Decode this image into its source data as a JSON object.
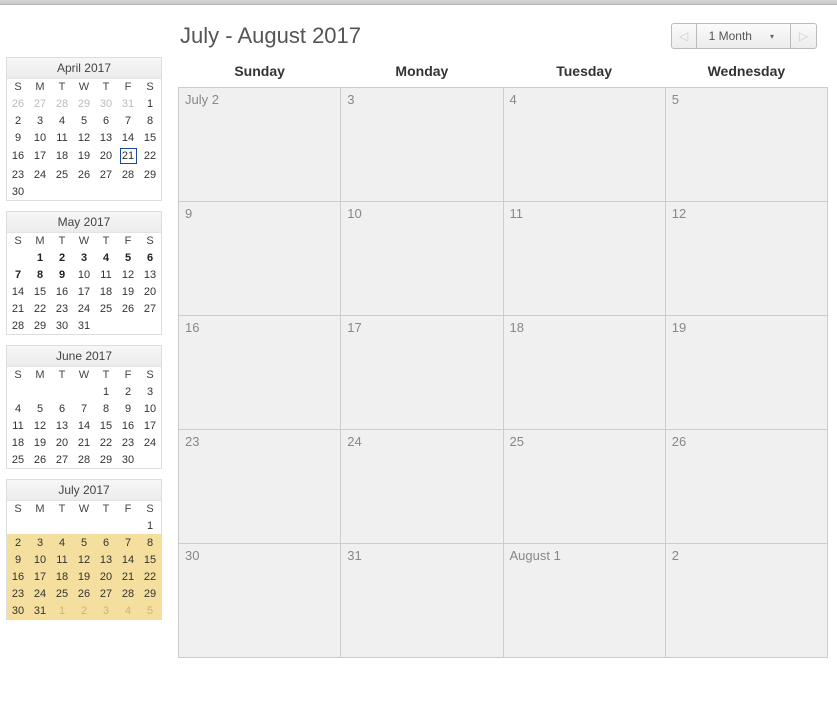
{
  "header": {
    "title": "July - August 2017",
    "range_label": "1 Month"
  },
  "day_short": [
    "S",
    "M",
    "T",
    "W",
    "T",
    "F",
    "S"
  ],
  "main_headers": [
    "Sunday",
    "Monday",
    "Tuesday",
    "Wednesday"
  ],
  "main_weeks": [
    [
      {
        "t": "July 2"
      },
      {
        "t": "3"
      },
      {
        "t": "4"
      },
      {
        "t": "5"
      }
    ],
    [
      {
        "t": "9"
      },
      {
        "t": "10"
      },
      {
        "t": "11"
      },
      {
        "t": "12"
      }
    ],
    [
      {
        "t": "16"
      },
      {
        "t": "17"
      },
      {
        "t": "18"
      },
      {
        "t": "19"
      }
    ],
    [
      {
        "t": "23"
      },
      {
        "t": "24"
      },
      {
        "t": "25"
      },
      {
        "t": "26"
      }
    ],
    [
      {
        "t": "30"
      },
      {
        "t": "31"
      },
      {
        "t": "August 1"
      },
      {
        "t": "2"
      }
    ]
  ],
  "minis": [
    {
      "title": "April 2017",
      "rows": [
        [
          {
            "t": "26",
            "cls": "mute"
          },
          {
            "t": "27",
            "cls": "mute"
          },
          {
            "t": "28",
            "cls": "mute"
          },
          {
            "t": "29",
            "cls": "mute"
          },
          {
            "t": "30",
            "cls": "mute"
          },
          {
            "t": "31",
            "cls": "mute"
          },
          {
            "t": "1"
          }
        ],
        [
          {
            "t": "2"
          },
          {
            "t": "3"
          },
          {
            "t": "4"
          },
          {
            "t": "5"
          },
          {
            "t": "6"
          },
          {
            "t": "7"
          },
          {
            "t": "8"
          }
        ],
        [
          {
            "t": "9"
          },
          {
            "t": "10"
          },
          {
            "t": "11"
          },
          {
            "t": "12"
          },
          {
            "t": "13"
          },
          {
            "t": "14"
          },
          {
            "t": "15"
          }
        ],
        [
          {
            "t": "16"
          },
          {
            "t": "17"
          },
          {
            "t": "18"
          },
          {
            "t": "19"
          },
          {
            "t": "20"
          },
          {
            "t": "21",
            "cls": "today"
          },
          {
            "t": "22"
          }
        ],
        [
          {
            "t": "23"
          },
          {
            "t": "24"
          },
          {
            "t": "25"
          },
          {
            "t": "26"
          },
          {
            "t": "27"
          },
          {
            "t": "28"
          },
          {
            "t": "29"
          }
        ],
        [
          {
            "t": "30"
          },
          {
            "t": ""
          },
          {
            "t": ""
          },
          {
            "t": ""
          },
          {
            "t": ""
          },
          {
            "t": ""
          },
          {
            "t": ""
          }
        ]
      ]
    },
    {
      "title": "May 2017",
      "rows": [
        [
          {
            "t": ""
          },
          {
            "t": "1",
            "cls": "bold"
          },
          {
            "t": "2",
            "cls": "bold"
          },
          {
            "t": "3",
            "cls": "bold"
          },
          {
            "t": "4",
            "cls": "bold"
          },
          {
            "t": "5",
            "cls": "bold"
          },
          {
            "t": "6",
            "cls": "bold"
          }
        ],
        [
          {
            "t": "7",
            "cls": "bold"
          },
          {
            "t": "8",
            "cls": "bold"
          },
          {
            "t": "9",
            "cls": "bold"
          },
          {
            "t": "10"
          },
          {
            "t": "11"
          },
          {
            "t": "12"
          },
          {
            "t": "13"
          }
        ],
        [
          {
            "t": "14"
          },
          {
            "t": "15"
          },
          {
            "t": "16"
          },
          {
            "t": "17"
          },
          {
            "t": "18"
          },
          {
            "t": "19"
          },
          {
            "t": "20"
          }
        ],
        [
          {
            "t": "21"
          },
          {
            "t": "22"
          },
          {
            "t": "23"
          },
          {
            "t": "24"
          },
          {
            "t": "25"
          },
          {
            "t": "26"
          },
          {
            "t": "27"
          }
        ],
        [
          {
            "t": "28"
          },
          {
            "t": "29"
          },
          {
            "t": "30"
          },
          {
            "t": "31"
          },
          {
            "t": ""
          },
          {
            "t": ""
          },
          {
            "t": ""
          }
        ]
      ]
    },
    {
      "title": "June 2017",
      "rows": [
        [
          {
            "t": ""
          },
          {
            "t": ""
          },
          {
            "t": ""
          },
          {
            "t": ""
          },
          {
            "t": "1"
          },
          {
            "t": "2"
          },
          {
            "t": "3"
          }
        ],
        [
          {
            "t": "4"
          },
          {
            "t": "5"
          },
          {
            "t": "6"
          },
          {
            "t": "7"
          },
          {
            "t": "8"
          },
          {
            "t": "9"
          },
          {
            "t": "10"
          }
        ],
        [
          {
            "t": "11"
          },
          {
            "t": "12"
          },
          {
            "t": "13"
          },
          {
            "t": "14"
          },
          {
            "t": "15"
          },
          {
            "t": "16"
          },
          {
            "t": "17"
          }
        ],
        [
          {
            "t": "18"
          },
          {
            "t": "19"
          },
          {
            "t": "20"
          },
          {
            "t": "21"
          },
          {
            "t": "22"
          },
          {
            "t": "23"
          },
          {
            "t": "24"
          }
        ],
        [
          {
            "t": "25"
          },
          {
            "t": "26"
          },
          {
            "t": "27"
          },
          {
            "t": "28"
          },
          {
            "t": "29"
          },
          {
            "t": "30"
          },
          {
            "t": ""
          }
        ]
      ]
    },
    {
      "title": "July 2017",
      "rows": [
        [
          {
            "t": ""
          },
          {
            "t": ""
          },
          {
            "t": ""
          },
          {
            "t": ""
          },
          {
            "t": ""
          },
          {
            "t": ""
          },
          {
            "t": "1"
          }
        ],
        [
          {
            "t": "2",
            "cls": "hl"
          },
          {
            "t": "3",
            "cls": "hl"
          },
          {
            "t": "4",
            "cls": "hl"
          },
          {
            "t": "5",
            "cls": "hl"
          },
          {
            "t": "6",
            "cls": "hl"
          },
          {
            "t": "7",
            "cls": "hl"
          },
          {
            "t": "8",
            "cls": "hl"
          }
        ],
        [
          {
            "t": "9",
            "cls": "hl"
          },
          {
            "t": "10",
            "cls": "hl"
          },
          {
            "t": "11",
            "cls": "hl"
          },
          {
            "t": "12",
            "cls": "hl"
          },
          {
            "t": "13",
            "cls": "hl"
          },
          {
            "t": "14",
            "cls": "hl"
          },
          {
            "t": "15",
            "cls": "hl"
          }
        ],
        [
          {
            "t": "16",
            "cls": "hl"
          },
          {
            "t": "17",
            "cls": "hl"
          },
          {
            "t": "18",
            "cls": "hl"
          },
          {
            "t": "19",
            "cls": "hl"
          },
          {
            "t": "20",
            "cls": "hl"
          },
          {
            "t": "21",
            "cls": "hl"
          },
          {
            "t": "22",
            "cls": "hl"
          }
        ],
        [
          {
            "t": "23",
            "cls": "hl"
          },
          {
            "t": "24",
            "cls": "hl"
          },
          {
            "t": "25",
            "cls": "hl"
          },
          {
            "t": "26",
            "cls": "hl"
          },
          {
            "t": "27",
            "cls": "hl"
          },
          {
            "t": "28",
            "cls": "hl"
          },
          {
            "t": "29",
            "cls": "hl"
          }
        ],
        [
          {
            "t": "30",
            "cls": "hl"
          },
          {
            "t": "31",
            "cls": "hl"
          },
          {
            "t": "1",
            "cls": "hl mute"
          },
          {
            "t": "2",
            "cls": "hl mute"
          },
          {
            "t": "3",
            "cls": "hl mute"
          },
          {
            "t": "4",
            "cls": "hl mute"
          },
          {
            "t": "5",
            "cls": "hl mute"
          }
        ]
      ]
    }
  ]
}
